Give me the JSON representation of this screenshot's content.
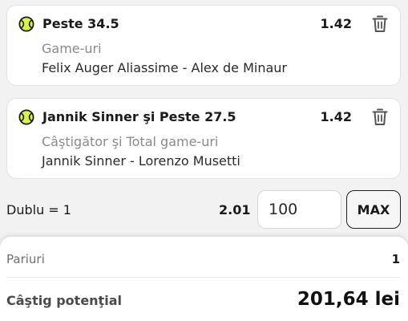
{
  "bets": [
    {
      "icon": "tennis-ball-icon",
      "title": "Peste 34.5",
      "odds": "1.42",
      "market": "Game-uri",
      "event": "Felix Auger Aliassime - Alex de Minaur"
    },
    {
      "icon": "tennis-ball-icon",
      "title": "Jannik Sinner şi Peste 27.5",
      "odds": "1.42",
      "market": "Câştigător şi Total game-uri",
      "event": "Jannik Sinner - Lorenzo Musetti"
    }
  ],
  "combo": {
    "label": "Dublu = 1",
    "odds": "2.01",
    "stake_value": "100",
    "max_label": "MAX"
  },
  "summary": {
    "bets_label": "Pariuri",
    "bets_count": "1",
    "payout_label": "Câştig potenţial",
    "payout_value": "201,64 lei"
  },
  "colors": {
    "ball_fill": "#d9f24a",
    "ball_stroke": "#1a1a1a",
    "muted_text": "#8a8a8a"
  }
}
